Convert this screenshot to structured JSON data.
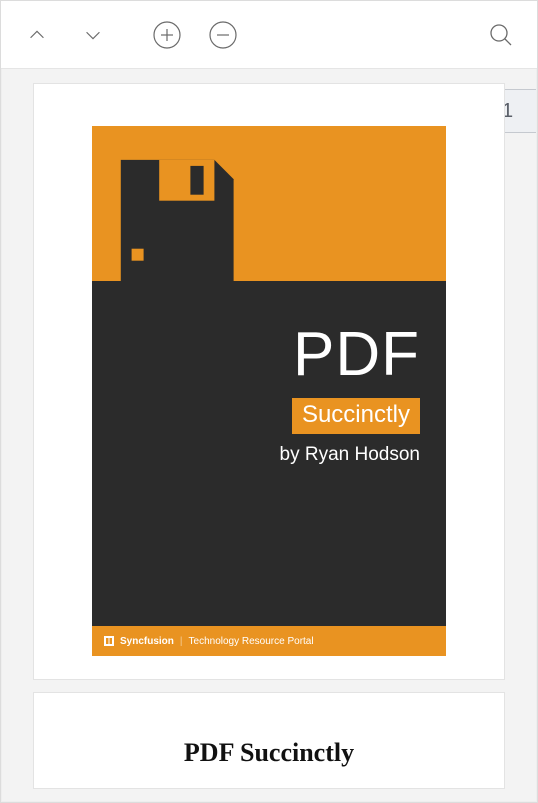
{
  "toolbar": {
    "prev": "previous-page",
    "next": "next-page",
    "zoom_in": "zoom-in",
    "zoom_out": "zoom-out",
    "search": "search"
  },
  "page_indicator": "1",
  "document": {
    "cover": {
      "title": "PDF",
      "subtitle": "Succinctly",
      "author": "by Ryan Hodson",
      "footer_brand": "Syncfusion",
      "footer_tagline": "Technology Resource Portal"
    },
    "page2_heading": "PDF Succinctly"
  },
  "colors": {
    "accent": "#e99321",
    "dark": "#2b2b2b"
  }
}
